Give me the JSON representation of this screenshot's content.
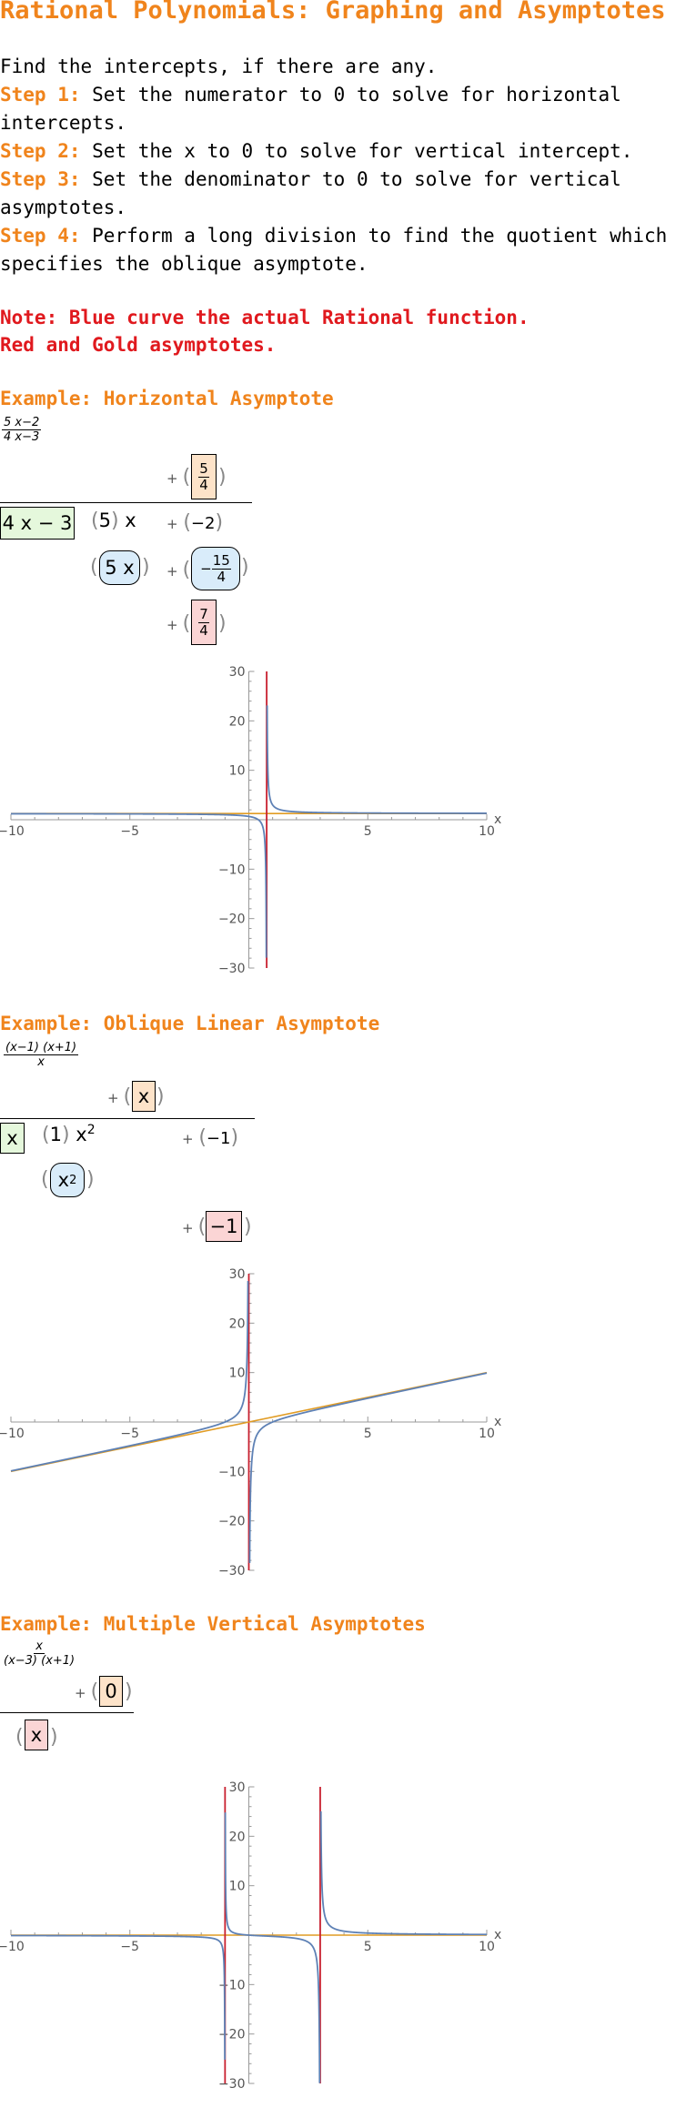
{
  "title": "Rational Polynomials: Graphing and Asymptotes",
  "intro": {
    "line0": "Find the intercepts, if there are any.",
    "steps": [
      {
        "label": "Step 1:",
        "text": " Set the numerator to 0 to solve for horizontal intercepts."
      },
      {
        "label": "Step 2:",
        "text": " Set the x to 0 to solve for vertical intercept."
      },
      {
        "label": "Step 3:",
        "text": " Set the denominator to 0 to solve for vertical asymptotes."
      },
      {
        "label": "Step 4:",
        "text": " Perform a long division to find the quotient which specifies the oblique asymptote."
      }
    ]
  },
  "note": {
    "line1": "Note: Blue curve the actual Rational function.",
    "line2": "Red and Gold asymptotes."
  },
  "ex1": {
    "heading": "Example: Horizontal Asymptote",
    "frac_num": "5 x−2",
    "frac_den": "4 x−3",
    "q_num": "5",
    "q_den": "4",
    "divisor": "4 x − 3",
    "dividend_1": "5",
    "dividend_1_var": "x",
    "dividend_2": "−2",
    "sub_term": "5 x",
    "sub_num": "15",
    "sub_den": "4",
    "rem_num": "7",
    "rem_den": "4"
  },
  "ex2": {
    "heading": "Example: Oblique Linear Asymptote",
    "frac_num": "(x−1) (x+1)",
    "frac_den": "x",
    "quotient": "x",
    "divisor": "x",
    "dividend_1": "1",
    "dividend_1_var": "x",
    "dividend_1_exp": "2",
    "dividend_2": "−1",
    "sub_term": "x",
    "sub_exp": "2",
    "remainder": "−1"
  },
  "ex3": {
    "heading": "Example: Multiple Vertical Asymptotes",
    "frac_num": "x",
    "frac_den": "(x−3) (x+1)",
    "quotient": "0",
    "remainder": "x"
  },
  "plot_axes": {
    "x_label": "x",
    "x_ticks": [
      "−10",
      "−5",
      "5",
      "10"
    ],
    "y_ticks": [
      "30",
      "20",
      "10",
      "−10",
      "−20",
      "−30"
    ],
    "xlim": [
      -10,
      10
    ],
    "ylim": [
      -30,
      30
    ]
  },
  "colors": {
    "curve": "#5e81b5",
    "vertical_asymptote": "#c8202f",
    "other_asymptote": "#e19c24",
    "heading": "#f0841c",
    "note": "#e0191e"
  },
  "chart_data": [
    {
      "type": "line",
      "function": "(5x-2)/(4x-3)",
      "xlim": [
        -10,
        10
      ],
      "ylim": [
        -30,
        30
      ],
      "x_ticks": [
        -10,
        -5,
        5,
        10
      ],
      "y_ticks": [
        -30,
        -20,
        -10,
        10,
        20,
        30
      ],
      "vertical_asymptotes": [
        0.75
      ],
      "horizontal_asymptote": 1.25
    },
    {
      "type": "line",
      "function": "(x-1)(x+1)/x",
      "xlim": [
        -10,
        10
      ],
      "ylim": [
        -30,
        30
      ],
      "x_ticks": [
        -10,
        -5,
        5,
        10
      ],
      "y_ticks": [
        -30,
        -20,
        -10,
        10,
        20,
        30
      ],
      "vertical_asymptotes": [
        0
      ],
      "oblique_asymptote": "y = x"
    },
    {
      "type": "line",
      "function": "x/((x-3)(x+1))",
      "xlim": [
        -10,
        10
      ],
      "ylim": [
        -30,
        30
      ],
      "x_ticks": [
        -10,
        -5,
        5,
        10
      ],
      "y_ticks": [
        -30,
        -20,
        -10,
        10,
        20,
        30
      ],
      "vertical_asymptotes": [
        -1,
        3
      ],
      "horizontal_asymptote": 0
    }
  ]
}
